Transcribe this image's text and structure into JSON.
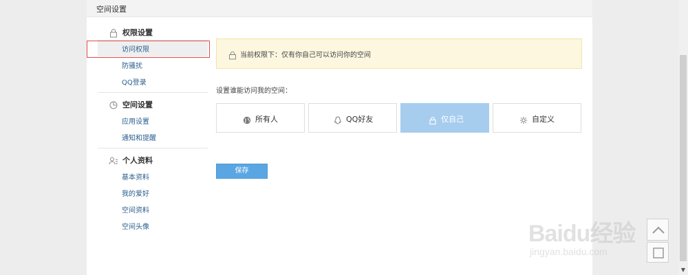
{
  "panel": {
    "title": "空间设置"
  },
  "sidebar": {
    "groups": [
      {
        "label": "权限设置",
        "icon": "lock-icon",
        "items": [
          {
            "label": "访问权限"
          },
          {
            "label": "防骚扰"
          },
          {
            "label": "QQ登录"
          }
        ]
      },
      {
        "label": "空间设置",
        "icon": "space-settings-icon",
        "items": [
          {
            "label": "应用设置"
          },
          {
            "label": "通知和提醒"
          }
        ]
      },
      {
        "label": "个人资料",
        "icon": "profile-icon",
        "items": [
          {
            "label": "基本资料"
          },
          {
            "label": "我的爱好"
          },
          {
            "label": "空间资料"
          },
          {
            "label": "空间头像"
          }
        ]
      }
    ]
  },
  "notice": {
    "text": "当前权限下：仅有你自己可以访问你的空间"
  },
  "prompt": "设置谁能访问我的空间：",
  "options": [
    {
      "label": "所有人",
      "icon": "globe-icon"
    },
    {
      "label": "QQ好友",
      "icon": "friend-icon"
    },
    {
      "label": "仅自己",
      "icon": "lock-icon"
    },
    {
      "label": "自定义",
      "icon": "gear-icon"
    }
  ],
  "selected_option": "仅自己",
  "save_label": "保存",
  "watermark": {
    "brand": "Baidu经验",
    "url": "jingyan.baidu.com"
  },
  "colors": {
    "selected": "#a7cdee",
    "save": "#5aa6e3",
    "notice_bg": "#fdf7e0",
    "highlight": "#e24a4a"
  }
}
